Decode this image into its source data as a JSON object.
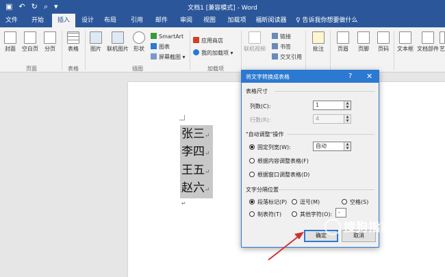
{
  "window": {
    "title": "文档1 [兼容模式] - Word"
  },
  "tabs": [
    "文件",
    "开始",
    "插入",
    "设计",
    "布局",
    "引用",
    "邮件",
    "审阅",
    "视图",
    "加载项",
    "福昕阅读器"
  ],
  "active_tab": "插入",
  "tell_me": "告诉我你想要做什么",
  "ribbon": {
    "buttons": {
      "cover": "封面",
      "blank": "空白页",
      "pagebreak": "分页",
      "table": "表格",
      "picture": "图片",
      "online_picture": "联机图片",
      "shapes": "形状",
      "smartart": "SmartArt",
      "chart": "图表",
      "screenshot": "屏幕截图",
      "store": "应用商店",
      "myaddins": "我的加载项",
      "online_video": "联机视频",
      "link": "链接",
      "bookmark": "书签",
      "crossref": "交叉引用",
      "comment": "批注",
      "header": "页眉",
      "footer": "页脚",
      "pagenum": "页码",
      "textbox": "文本框",
      "docparts": "文档部件",
      "art": "艺"
    },
    "groups": {
      "pages": "页面",
      "tables": "表格",
      "illustrations": "插图",
      "addins": "加载项",
      "media": "媒体",
      "links": "链接",
      "comments": "批注",
      "headerfooter": "页眉和页脚"
    }
  },
  "document": {
    "lines": [
      "张三",
      "李四",
      "王五",
      "赵六"
    ],
    "para_mark": "↵"
  },
  "dialog": {
    "title": "将文字转换成表格",
    "help": "?",
    "close": "✕",
    "size_section": "表格尺寸",
    "cols_label": "列数(C):",
    "cols_value": "1",
    "rows_label": "行数(R):",
    "rows_value": "4",
    "autofit_section": "\"自动调整\"操作",
    "fixed_width": "固定列宽(W):",
    "fixed_value": "自动",
    "fit_content": "根据内容调整表格(F)",
    "fit_window": "根据窗口调整表格(D)",
    "sep_section": "文字分隔位置",
    "sep_paragraph": "段落标记(P)",
    "sep_comma": "逗号(M)",
    "sep_space": "空格(S)",
    "sep_tab": "制表符(T)",
    "sep_other": "其他字符(O):",
    "sep_other_value": "-",
    "ok": "确定",
    "cancel": "取消"
  },
  "watermark": {
    "brand": "搜狗指南",
    "url": "zhinan.sogou.com"
  },
  "colors": {
    "word_blue": "#2b579a",
    "dialog_blue": "#2b79d0",
    "arrow_red": "#d03030"
  }
}
